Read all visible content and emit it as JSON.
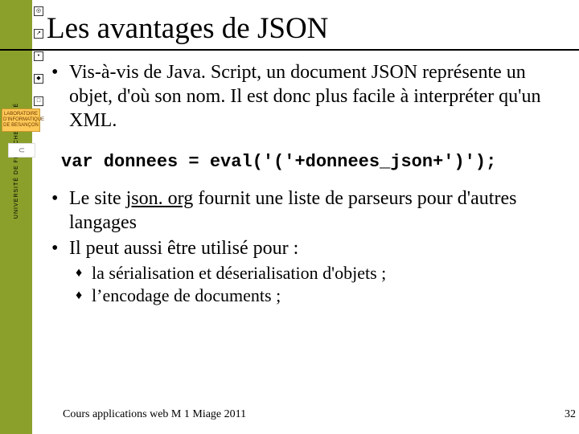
{
  "sidebar": {
    "vertical_text": "UNIVERSITÉ DE FRANCHE-COMTÉ",
    "lab_text": "LABORATOIRE D'INFORMATIQUE DE BESANÇON",
    "foot_glyph": "⊂"
  },
  "title": "Les avantages de JSON",
  "bullets": {
    "b1": "Vis-à-vis de Java. Script, un document JSON représente un objet, d'où son nom. Il est donc plus facile à interpréter qu'un XML."
  },
  "code": "var donnees = eval('('+donnees_json+')');",
  "bullets2": {
    "b2_pre": "Le site ",
    "b2_link": "json. org",
    "b2_post": " fournit une liste de parseurs pour d'autres langages",
    "b3": "Il peut aussi être utilisé pour :"
  },
  "diamond": {
    "d1": "la sérialisation et déserialisation d'objets ;",
    "d2": "l’encodage de documents ;"
  },
  "footer": "Cours applications web M 1 Miage 2011",
  "page_number": "32"
}
